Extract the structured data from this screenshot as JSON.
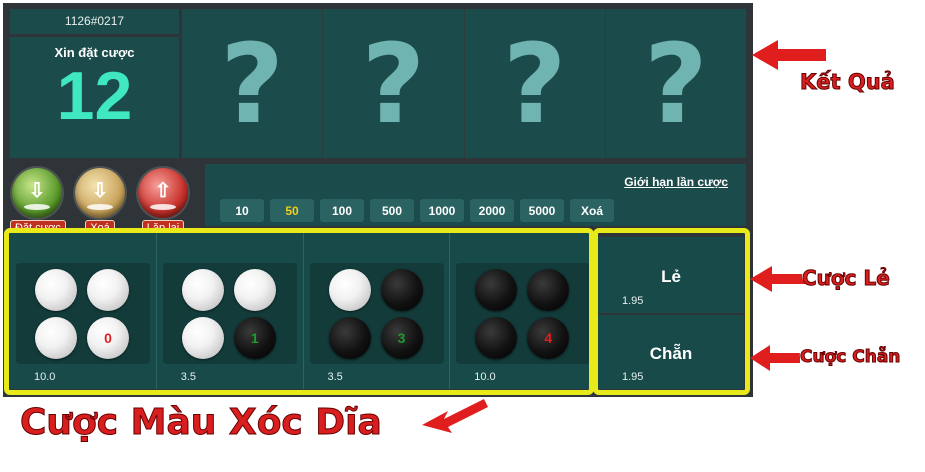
{
  "header": {
    "round_id": "1126#0217",
    "countdown_title": "Xin đặt cược",
    "countdown_value": "12"
  },
  "results": [
    "?",
    "?",
    "?",
    "?"
  ],
  "actions": [
    {
      "label": "Đặt cược",
      "icon": "download-icon"
    },
    {
      "label": "Xoá",
      "icon": "clear-icon"
    },
    {
      "label": "Lặp lại",
      "icon": "upload-icon"
    }
  ],
  "chips_panel": {
    "limit_link": "Giới hạn lần cược",
    "chips": [
      "10",
      "50",
      "100",
      "500",
      "1000",
      "2000",
      "5000",
      "Xoá"
    ],
    "selected": "50"
  },
  "color_bets": [
    {
      "discs": [
        "white",
        "white",
        "white",
        "white"
      ],
      "count_label": "0",
      "odds": "10.0"
    },
    {
      "discs": [
        "white",
        "white",
        "white",
        "black"
      ],
      "count_label": "1",
      "odds": "3.5"
    },
    {
      "discs": [
        "white",
        "black",
        "black",
        "black"
      ],
      "count_label": "3",
      "odds": "3.5"
    },
    {
      "discs": [
        "black",
        "black",
        "black",
        "black"
      ],
      "count_label": "4",
      "odds": "10.0"
    }
  ],
  "odd_even": {
    "odd": {
      "label": "Lẻ",
      "odds": "1.95"
    },
    "even": {
      "label": "Chẵn",
      "odds": "1.95"
    }
  },
  "annotations": {
    "result": "Kết Quả",
    "odd_bet": "Cược Lẻ",
    "even_bet": "Cược Chẵn",
    "color_bet": "Cược Màu Xóc Dĩa"
  },
  "colors": {
    "panel": "#1b4b4a",
    "frame": "#2e3437",
    "countdown": "#3fe8c0",
    "highlight": "#e8ea1a",
    "annotation": "#d81e1e",
    "chip_selected": "#f2d01a"
  }
}
